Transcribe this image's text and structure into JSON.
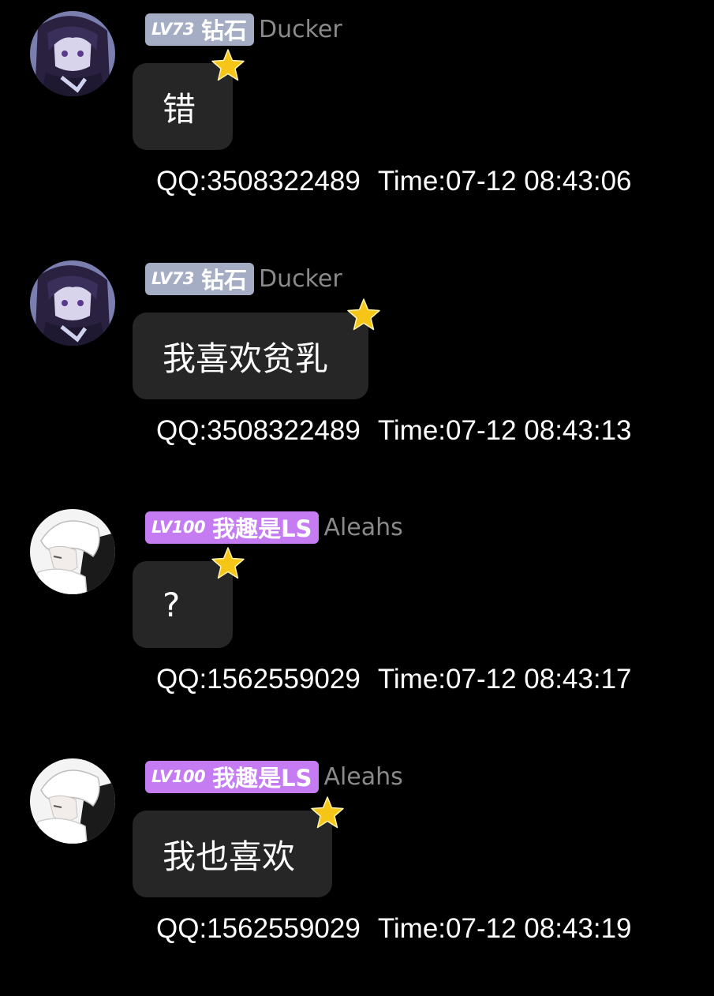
{
  "messages": [
    {
      "badge": {
        "level": "LV73",
        "title": "钻石",
        "color": "#a4adc3"
      },
      "nickname": "Ducker",
      "text": "错",
      "qq": "QQ:3508322489",
      "time": "Time:07-12 08:43:06",
      "avatar": "anime-girl-dark-hair-avatar"
    },
    {
      "badge": {
        "level": "LV73",
        "title": "钻石",
        "color": "#a4adc3"
      },
      "nickname": "Ducker",
      "text": "我喜欢贫乳",
      "qq": "QQ:3508322489",
      "time": "Time:07-12 08:43:13",
      "avatar": "anime-girl-dark-hair-avatar"
    },
    {
      "badge": {
        "level": "LV100",
        "title": "我趣是LS",
        "color": "#c57cf2"
      },
      "nickname": "Aleahs",
      "text": "?",
      "qq": "QQ:1562559029",
      "time": "Time:07-12 08:43:17",
      "avatar": "white-hair-boy-avatar"
    },
    {
      "badge": {
        "level": "LV100",
        "title": "我趣是LS",
        "color": "#c57cf2"
      },
      "nickname": "Aleahs",
      "text": "我也喜欢",
      "qq": "QQ:1562559029",
      "time": "Time:07-12 08:43:19",
      "avatar": "white-hair-boy-avatar"
    }
  ],
  "icons": {
    "star": "star-icon"
  },
  "colors": {
    "background": "#000000",
    "bubble": "#262626",
    "nickname": "#8a8a8a",
    "star": "#f5c518"
  }
}
